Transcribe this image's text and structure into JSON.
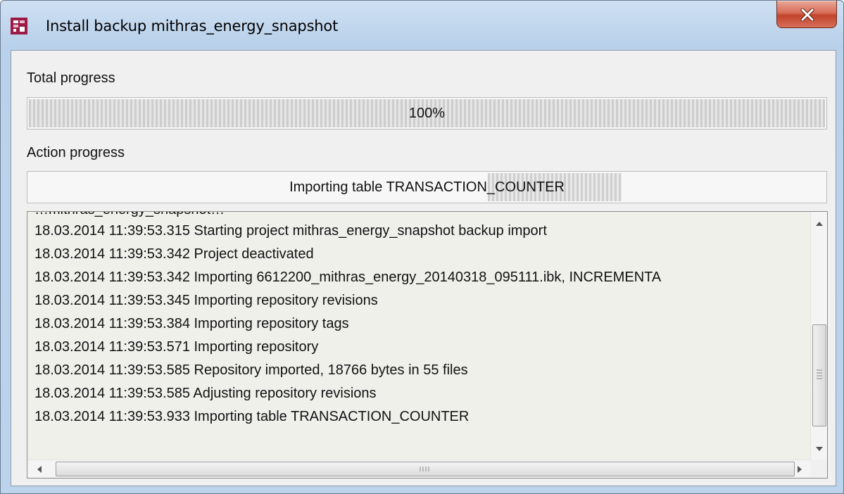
{
  "window": {
    "title": "Install backup mithras_energy_snapshot",
    "icons": {
      "app": "fs-logo-icon",
      "close": "close-icon"
    },
    "colors": {
      "close_button": "#c7432b",
      "app_icon": "#9c1b46"
    }
  },
  "total_progress": {
    "label": "Total progress",
    "value_text": "100%",
    "percent": 100
  },
  "action_progress": {
    "label": "Action progress",
    "status_text": "Importing table TRANSACTION_COUNTER"
  },
  "log": {
    "partial_line": "…mithras_energy_snapshot…",
    "lines": [
      "18.03.2014 11:39:53.315 Starting project mithras_energy_snapshot backup import",
      "18.03.2014 11:39:53.342 Project deactivated",
      "18.03.2014 11:39:53.342 Importing 6612200_mithras_energy_20140318_095111.ibk, INCREMENTA",
      "18.03.2014 11:39:53.345 Importing repository revisions",
      "18.03.2014 11:39:53.384 Importing repository tags",
      "18.03.2014 11:39:53.571 Importing repository",
      "18.03.2014 11:39:53.585 Repository imported, 18766 bytes in 55 files",
      "18.03.2014 11:39:53.585 Adjusting repository revisions",
      "18.03.2014 11:39:53.933 Importing table TRANSACTION_COUNTER"
    ]
  }
}
